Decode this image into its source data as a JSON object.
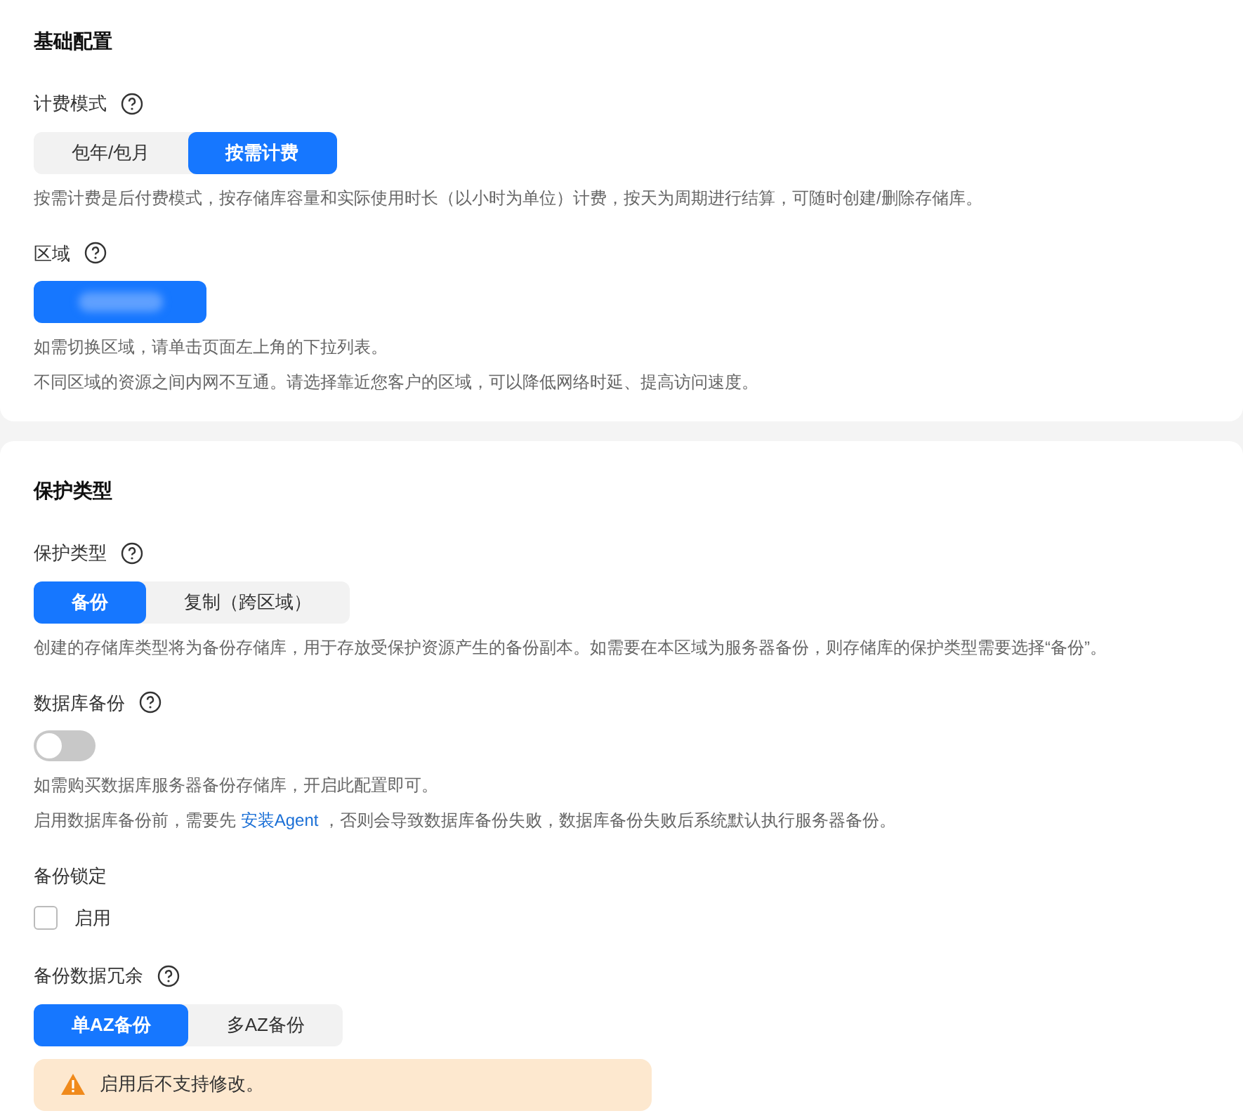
{
  "sections": [
    {
      "title": "基础配置",
      "fields": [
        {
          "kind": "segmented",
          "label": "计费模式",
          "help": true,
          "options": [
            {
              "label": "包年/包月",
              "selected": false
            },
            {
              "label": "按需计费",
              "selected": true
            }
          ],
          "notes": [
            {
              "parts": [
                {
                  "kind": "text",
                  "text": "按需计费是后付费模式，按存储库容量和实际使用时长（以小时为单位）计费，按天为周期进行结算，可随时创建/删除存储库。"
                }
              ]
            }
          ]
        },
        {
          "kind": "region",
          "label": "区域",
          "help": true,
          "notes": [
            {
              "parts": [
                {
                  "kind": "text",
                  "text": "如需切换区域，请单击页面左上角的下拉列表。"
                }
              ]
            },
            {
              "parts": [
                {
                  "kind": "text",
                  "text": "不同区域的资源之间内网不互通。请选择靠近您客户的区域，可以降低网络时延、提高访问速度。"
                }
              ]
            }
          ]
        }
      ]
    },
    {
      "title": "保护类型",
      "fields": [
        {
          "kind": "segmented",
          "label": "保护类型",
          "help": true,
          "options": [
            {
              "label": "备份",
              "selected": true
            },
            {
              "label": "复制（跨区域）",
              "selected": false
            }
          ],
          "notes": [
            {
              "parts": [
                {
                  "kind": "text",
                  "text": "创建的存储库类型将为备份存储库，用于存放受保护资源产生的备份副本。如需要在本区域为服务器备份，则存储库的保护类型需要选择“备份”。"
                }
              ]
            }
          ]
        },
        {
          "kind": "toggle",
          "label": "数据库备份",
          "help": true,
          "on": false,
          "notes": [
            {
              "parts": [
                {
                  "kind": "text",
                  "text": "如需购买数据库服务器备份存储库，开启此配置即可。"
                }
              ]
            },
            {
              "parts": [
                {
                  "kind": "text",
                  "text": "启用数据库备份前，需要先 "
                },
                {
                  "kind": "link",
                  "text": "安装Agent"
                },
                {
                  "kind": "text",
                  "text": " ，否则会导致数据库备份失败，数据库备份失败后系统默认执行服务器备份。"
                }
              ]
            }
          ]
        },
        {
          "kind": "checkbox",
          "label": "备份锁定",
          "help": false,
          "checked": false,
          "option": "启用"
        },
        {
          "kind": "segmented",
          "label": "备份数据冗余",
          "help": true,
          "options": [
            {
              "label": "单AZ备份",
              "selected": true
            },
            {
              "label": "多AZ备份",
              "selected": false
            }
          ],
          "alert": "启用后不支持修改。"
        }
      ]
    }
  ]
}
